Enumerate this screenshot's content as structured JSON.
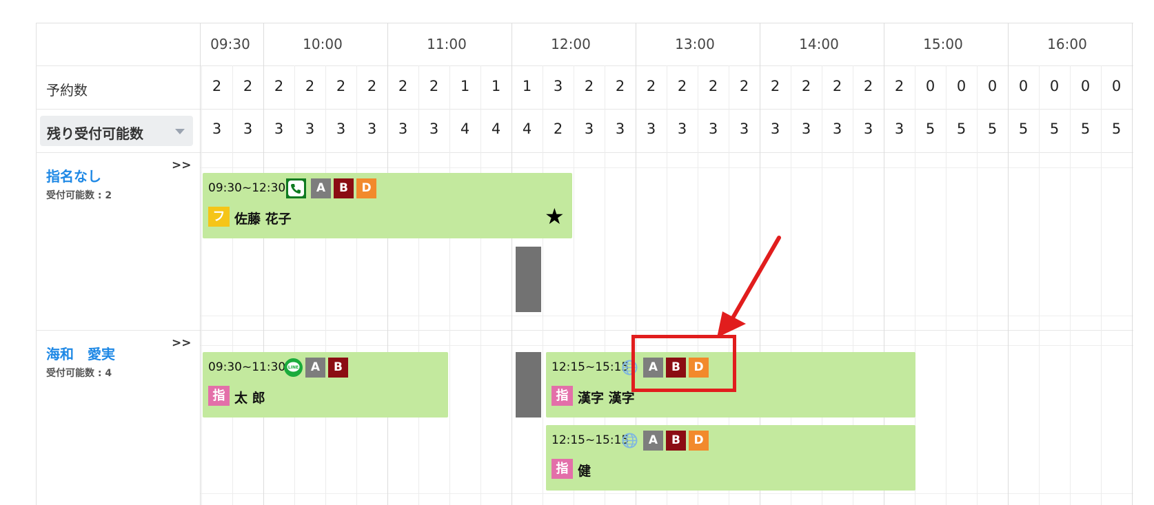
{
  "header": {
    "times": [
      "09:30",
      "10:00",
      "11:00",
      "12:00",
      "13:00",
      "14:00",
      "15:00",
      "16:00"
    ]
  },
  "rows": {
    "reservations_label": "予約数",
    "remaining_label": "残り受付可能数",
    "reservations": [
      "2",
      "2",
      "2",
      "2",
      "2",
      "2",
      "2",
      "2",
      "1",
      "1",
      "1",
      "3",
      "2",
      "2",
      "2",
      "2",
      "2",
      "2",
      "2",
      "2",
      "2",
      "2",
      "2",
      "0",
      "0",
      "0",
      "0",
      "0",
      "0",
      "0"
    ],
    "remaining": [
      "3",
      "3",
      "3",
      "3",
      "3",
      "3",
      "3",
      "3",
      "4",
      "4",
      "4",
      "2",
      "3",
      "3",
      "3",
      "3",
      "3",
      "3",
      "3",
      "3",
      "3",
      "3",
      "3",
      "5",
      "5",
      "5",
      "5",
      "5",
      "5",
      "5"
    ]
  },
  "staff": [
    {
      "name": "指名なし",
      "sub": "受付可能数 : 2",
      "expand": ">>",
      "appointments": [
        {
          "time": "09:30~12:30",
          "badges": [
            "A",
            "B",
            "D"
          ],
          "tag": "フ",
          "name": "佐藤 花子",
          "star": "★",
          "channel": "phone-icon"
        }
      ]
    },
    {
      "name": "海和　愛実",
      "sub": "受付可能数 : 4",
      "expand": ">>",
      "appointments": [
        {
          "time": "09:30~11:30",
          "badges": [
            "A",
            "B"
          ],
          "tag": "指",
          "name": "太 郎",
          "channel": "line-icon",
          "channel_text": "LINE"
        },
        {
          "time": "12:15~15:15",
          "badges": [
            "A",
            "B",
            "D"
          ],
          "tag": "指",
          "name": "漢字 漢字",
          "channel": "globe-icon"
        },
        {
          "time": "12:15~15:15",
          "badges": [
            "A",
            "B",
            "D"
          ],
          "tag": "指",
          "name": "健",
          "channel": "globe-icon"
        }
      ]
    }
  ],
  "colors": {
    "appointment_bg": "#c3e99e",
    "badge_a": "#7d7d7d",
    "badge_b": "#8b0d13",
    "badge_d": "#f28a2c",
    "annotation": "#e11d1d",
    "staff_name": "#1e88e5"
  }
}
